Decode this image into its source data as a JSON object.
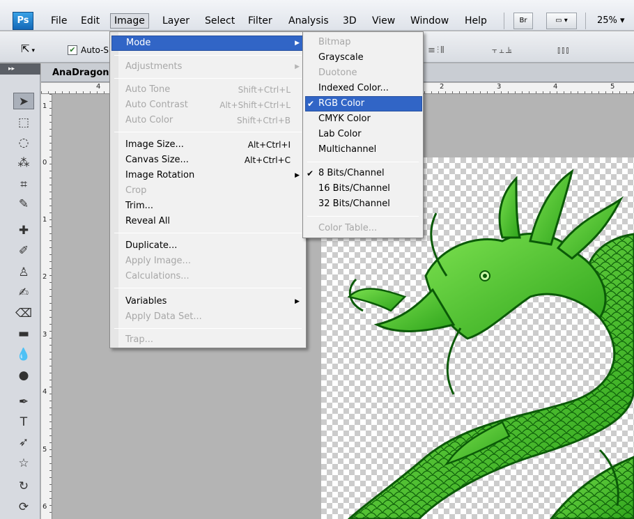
{
  "app": {
    "logo": "Ps"
  },
  "menubar": {
    "items": [
      "File",
      "Edit",
      "Image",
      "Layer",
      "Select",
      "Filter",
      "Analysis",
      "3D",
      "View",
      "Window",
      "Help"
    ],
    "active": "Image",
    "bridge_label": "Br",
    "zoom": "25%",
    "zoom_arrow": "▾"
  },
  "options": {
    "auto_select_label": "Auto-S"
  },
  "document": {
    "tab_title": "AnaDragon"
  },
  "ruler": {
    "h": [
      "4",
      "2",
      "3",
      "4",
      "5"
    ],
    "v": [
      "1",
      "0",
      "1",
      "2",
      "3",
      "4",
      "5",
      "6"
    ]
  },
  "image_menu": {
    "mode": {
      "label": "Mode"
    },
    "adjustments": {
      "label": "Adjustments"
    },
    "auto_tone": {
      "label": "Auto Tone",
      "shortcut": "Shift+Ctrl+L"
    },
    "auto_contrast": {
      "label": "Auto Contrast",
      "shortcut": "Alt+Shift+Ctrl+L"
    },
    "auto_color": {
      "label": "Auto Color",
      "shortcut": "Shift+Ctrl+B"
    },
    "image_size": {
      "label": "Image Size...",
      "shortcut": "Alt+Ctrl+I"
    },
    "canvas_size": {
      "label": "Canvas Size...",
      "shortcut": "Alt+Ctrl+C"
    },
    "image_rotation": {
      "label": "Image Rotation"
    },
    "crop": {
      "label": "Crop"
    },
    "trim": {
      "label": "Trim..."
    },
    "reveal_all": {
      "label": "Reveal All"
    },
    "duplicate": {
      "label": "Duplicate..."
    },
    "apply_image": {
      "label": "Apply Image..."
    },
    "calculations": {
      "label": "Calculations..."
    },
    "variables": {
      "label": "Variables"
    },
    "apply_data_set": {
      "label": "Apply Data Set..."
    },
    "trap": {
      "label": "Trap..."
    }
  },
  "mode_menu": {
    "bitmap": "Bitmap",
    "grayscale": "Grayscale",
    "duotone": "Duotone",
    "indexed": "Indexed Color...",
    "rgb": "RGB Color",
    "cmyk": "CMYK Color",
    "lab": "Lab Color",
    "multichannel": "Multichannel",
    "bits8": "8 Bits/Channel",
    "bits16": "16 Bits/Channel",
    "bits32": "32 Bits/Channel",
    "color_table": "Color Table..."
  },
  "colors": {
    "menu_highlight": "#3165c6",
    "dragon_green": "#3fbf1f",
    "dragon_outline": "#0b5a08"
  }
}
